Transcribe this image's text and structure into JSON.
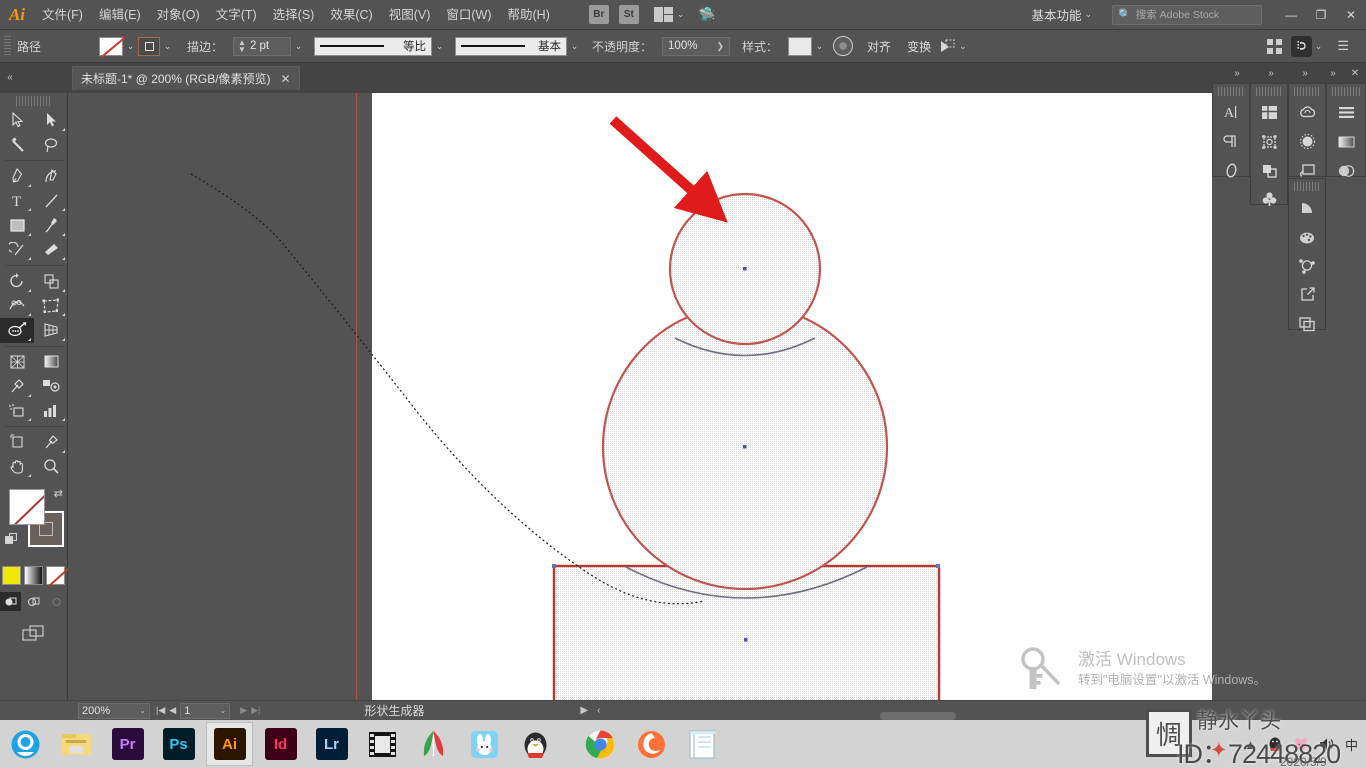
{
  "app": {
    "name": "Ai",
    "title": "Adobe Illustrator"
  },
  "menubar": {
    "items": [
      {
        "label": "文件(F)"
      },
      {
        "label": "编辑(E)"
      },
      {
        "label": "对象(O)"
      },
      {
        "label": "文字(T)"
      },
      {
        "label": "选择(S)"
      },
      {
        "label": "效果(C)"
      },
      {
        "label": "视图(V)"
      },
      {
        "label": "窗口(W)"
      },
      {
        "label": "帮助(H)"
      }
    ],
    "bridge_badge": "Br",
    "stock_badge": "St",
    "workspace": "基本功能",
    "search_placeholder": "搜索 Adobe Stock",
    "window_minimize": "—",
    "window_restore": "❐",
    "window_close": "✕"
  },
  "optionsbar": {
    "context_label": "路径",
    "fill_value": "无",
    "stroke_swatch": "描边色",
    "stroke_label": "描边：",
    "stroke_weight": "2 pt",
    "stroke_profile": "等比",
    "brush_definition": "基本",
    "opacity_label": "不透明度：",
    "opacity_value": "100%",
    "style_label": "样式：",
    "align_label": "对齐",
    "transform_label": "变换",
    "arrange_label": "排列"
  },
  "tabs": {
    "document": "未标题-1* @ 200% (RGB/像素预览)",
    "close": "✕"
  },
  "toolbar": {
    "tools": [
      {
        "name": "selection-tool",
        "label": "选择工具"
      },
      {
        "name": "direct-selection-tool",
        "label": "直接选择工具"
      },
      {
        "name": "magic-wand-tool",
        "label": "魔棒工具"
      },
      {
        "name": "lasso-tool",
        "label": "套索工具"
      },
      {
        "name": "pen-tool",
        "label": "钢笔工具"
      },
      {
        "name": "curvature-tool",
        "label": "曲率工具"
      },
      {
        "name": "type-tool",
        "label": "文字工具"
      },
      {
        "name": "line-segment-tool",
        "label": "直线段工具"
      },
      {
        "name": "rectangle-tool",
        "label": "矩形工具"
      },
      {
        "name": "paintbrush-tool",
        "label": "画笔工具"
      },
      {
        "name": "shaper-tool",
        "label": "Shaper 工具"
      },
      {
        "name": "eraser-tool",
        "label": "橡皮擦工具"
      },
      {
        "name": "rotate-tool",
        "label": "旋转工具"
      },
      {
        "name": "scale-tool",
        "label": "比例缩放工具"
      },
      {
        "name": "width-tool",
        "label": "宽度工具"
      },
      {
        "name": "free-transform-tool",
        "label": "自由变换工具"
      },
      {
        "name": "shape-builder-tool",
        "label": "形状生成器工具"
      },
      {
        "name": "perspective-grid-tool",
        "label": "透视网格工具"
      },
      {
        "name": "mesh-tool",
        "label": "网格工具"
      },
      {
        "name": "gradient-tool",
        "label": "渐变工具"
      },
      {
        "name": "eyedropper-tool",
        "label": "吸管工具"
      },
      {
        "name": "blend-tool",
        "label": "混合工具"
      },
      {
        "name": "symbol-sprayer-tool",
        "label": "符号喷枪工具"
      },
      {
        "name": "column-graph-tool",
        "label": "柱形图工具"
      },
      {
        "name": "artboard-tool",
        "label": "画板工具"
      },
      {
        "name": "slice-tool",
        "label": "切片工具"
      },
      {
        "name": "hand-tool",
        "label": "抓手工具"
      },
      {
        "name": "zoom-tool",
        "label": "缩放工具"
      }
    ],
    "active_tool": "shape-builder-tool",
    "fill_color": "无",
    "stroke_color": "#6b5f5a",
    "color_mode_labels": [
      "颜色",
      "渐变",
      "无"
    ],
    "draw_modes": [
      "正常绘图",
      "背面绘图",
      "内部绘图"
    ],
    "screen_mode": "更改屏幕模式"
  },
  "rightdock": {
    "collapse_glyph": "»",
    "close_glyph": "✕",
    "groups": [
      {
        "name": "type-panels",
        "icons": [
          "character-panel-icon",
          "paragraph-panel-icon",
          "opentype-panel-icon"
        ]
      },
      {
        "name": "layout-panels",
        "icons": [
          "artboards-panel-icon",
          "transform-panel-icon",
          "pathfinder-panel-icon",
          "symbols-panel-icon"
        ]
      },
      {
        "name": "cc-panels",
        "icons": [
          "creative-cloud-libraries-icon",
          "brushes-panel-icon",
          "links-panel-icon"
        ]
      },
      {
        "name": "appearance-panels",
        "icons": [
          "align-panel-icon",
          "gradient-panel-icon",
          "appearance-panel-icon"
        ]
      },
      {
        "name": "color-panels",
        "icons": [
          "color-guide-icon",
          "swatches-panel-icon",
          "color-panel-icon",
          "export-panel-icon",
          "layers-panel-icon"
        ]
      }
    ]
  },
  "statusbar": {
    "zoom_level": "200%",
    "page_number": "1",
    "current_tool": "形状生成器",
    "first_glyph": "|◀",
    "prev_glyph": "◀",
    "next_glyph": "▶",
    "last_glyph": "▶|"
  },
  "canvas": {
    "artwork": {
      "head_circle": {
        "name": "head-circle",
        "stroke": "#c1544c",
        "fill": "#e8e8e8"
      },
      "body_circle": {
        "name": "body-circle",
        "stroke": "#c1544c",
        "fill": "#e8e8e8"
      },
      "base_rectangle": {
        "name": "base-rectangle",
        "stroke": "#b5392f",
        "fill": "#e8e8e8"
      },
      "shape_builder_path": {
        "name": "shape-builder-drag-path"
      },
      "annotation_arrow": {
        "name": "red-annotation-arrow",
        "color": "#e11b1b"
      }
    }
  },
  "windows_activation": {
    "title": "激活 Windows",
    "subtitle": "转到\"电脑设置\"以激活 Windows。"
  },
  "taskbar": {
    "apps": [
      {
        "name": "360-browser",
        "label": "",
        "color": "#ffffff"
      },
      {
        "name": "file-explorer",
        "label": "",
        "color": "#f7d97a"
      },
      {
        "name": "adobe-premiere-pro",
        "label": "Pr",
        "color": "#2a0a3a",
        "text": "#c77bff"
      },
      {
        "name": "adobe-photoshop",
        "label": "Ps",
        "color": "#001d26",
        "text": "#31c5f0"
      },
      {
        "name": "adobe-illustrator",
        "label": "Ai",
        "color": "#2b1400",
        "text": "#ff9a00",
        "running": true
      },
      {
        "name": "adobe-indesign",
        "label": "Id",
        "color": "#3d0016",
        "text": "#ff3366"
      },
      {
        "name": "adobe-lightroom",
        "label": "Lr",
        "color": "#001e36",
        "text": "#9fd6f5"
      },
      {
        "name": "video-editor",
        "label": "",
        "color": "#1a1a1a"
      },
      {
        "name": "wps-office",
        "label": "",
        "color": "#ffffff"
      },
      {
        "name": "rabbit-app",
        "label": "",
        "color": "#7fd4f5"
      },
      {
        "name": "qq-messenger",
        "label": "",
        "color": "#ffffff"
      },
      {
        "name": "google-chrome",
        "label": "",
        "color": "#ffffff"
      },
      {
        "name": "firefox-browser",
        "label": "",
        "color": "#ff7139"
      },
      {
        "name": "notes-app",
        "label": "",
        "color": "#cfe8f7"
      }
    ],
    "tray": {
      "show_hidden": "▲",
      "icons": [
        "qq-tray-icon",
        "pink-tray-icon",
        "volume-icon",
        "ime-icon"
      ],
      "ime_label": "中",
      "date": "2020/5/9"
    }
  },
  "watermark": {
    "logo_char": "惆",
    "author": "静水丫头",
    "id_text": "ID：72448820",
    "date": "2020/5/9"
  }
}
